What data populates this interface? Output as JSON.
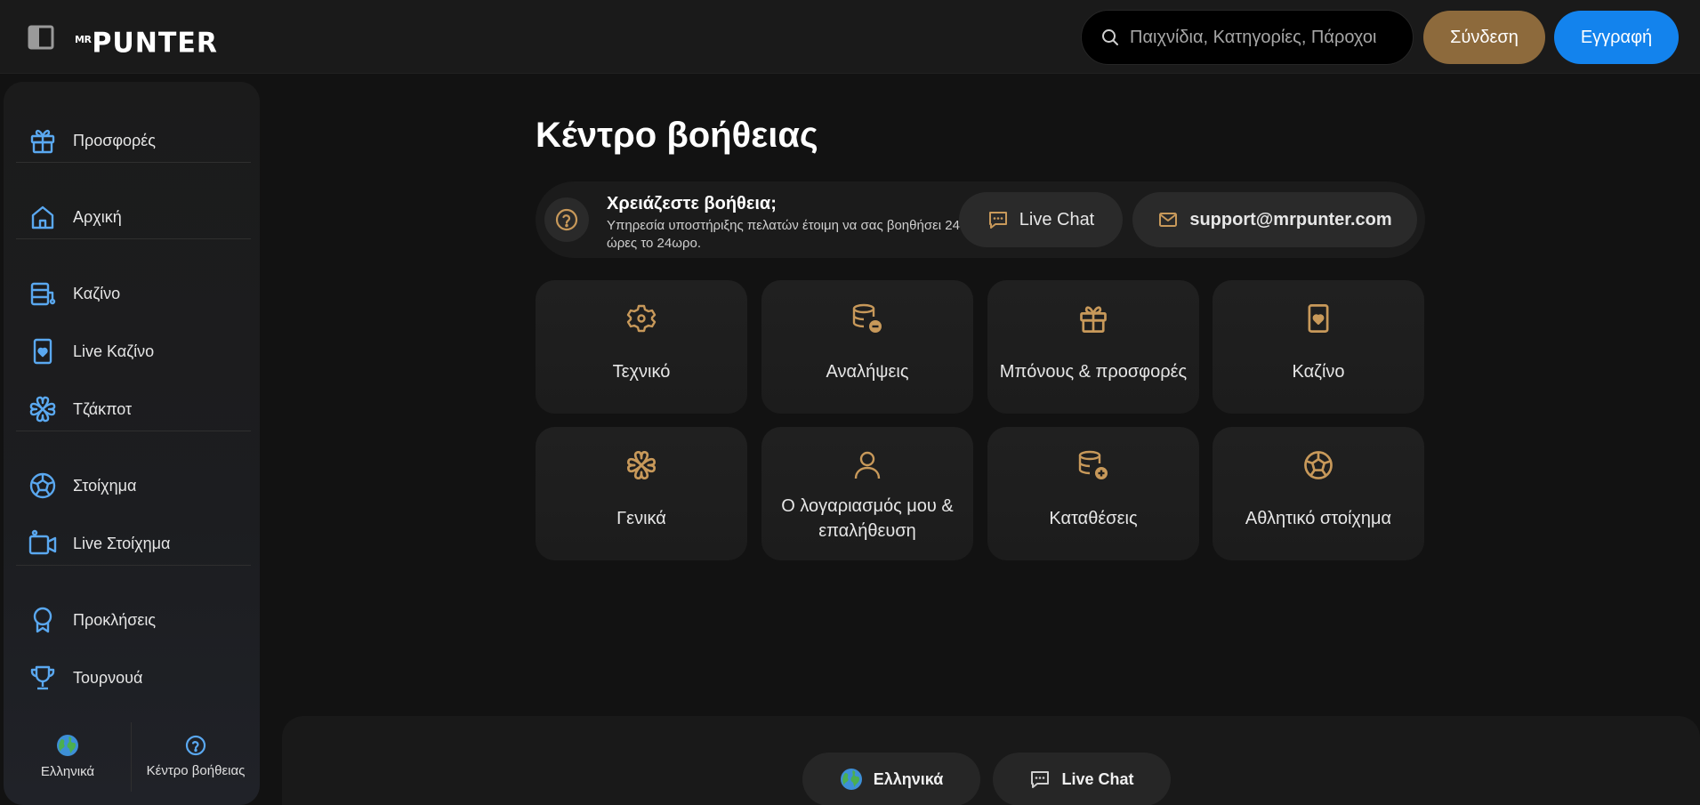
{
  "header": {
    "logo_small": "MR",
    "logo_main": "PUNTER",
    "search_placeholder": "Παιχνίδια, Κατηγορίες, Πάροχοι",
    "login_label": "Σύνδεση",
    "register_label": "Εγγραφή"
  },
  "sidebar": {
    "items": [
      {
        "label": "Προσφορές",
        "icon": "gift-icon"
      },
      {
        "label": "Αρχική",
        "icon": "home-icon"
      },
      {
        "label": "Καζίνο",
        "icon": "casino-icon"
      },
      {
        "label": "Live Καζίνο",
        "icon": "card-heart-icon"
      },
      {
        "label": "Τζάκποτ",
        "icon": "clover-icon"
      },
      {
        "label": "Στοίχημα",
        "icon": "soccer-ball-icon"
      },
      {
        "label": "Live Στοίχημα",
        "icon": "video-camera-icon"
      },
      {
        "label": "Προκλήσεις",
        "icon": "badge-icon"
      },
      {
        "label": "Τουρνουά",
        "icon": "trophy-icon"
      }
    ],
    "bottom": {
      "language_label": "Ελληνικά",
      "help_label": "Κέντρο βοήθειας"
    }
  },
  "main": {
    "title": "Κέντρο βοήθειας",
    "help_bar": {
      "title": "Χρειάζεστε βοήθεια;",
      "subtitle": "Υπηρεσία υποστήριξης πελατών έτοιμη να σας βοηθήσει 24 ώρες το 24ωρο.",
      "live_chat_label": "Live Chat",
      "email_label": "support@mrpunter.com"
    },
    "categories": [
      {
        "label": "Τεχνικό",
        "icon": "gear-icon"
      },
      {
        "label": "Αναλήψεις",
        "icon": "coins-minus-icon"
      },
      {
        "label": "Μπόνους & προσφορές",
        "icon": "gift-icon"
      },
      {
        "label": "Καζίνο",
        "icon": "card-heart-icon"
      },
      {
        "label": "Γενικά",
        "icon": "clover-icon"
      },
      {
        "label": "Ο λογαριασμός μου & επαλήθευση",
        "icon": "user-icon"
      },
      {
        "label": "Καταθέσεις",
        "icon": "coins-plus-icon"
      },
      {
        "label": "Αθλητικό στοίχημα",
        "icon": "soccer-ball-icon"
      }
    ]
  },
  "footer": {
    "language_label": "Ελληνικά",
    "live_chat_label": "Live Chat"
  },
  "colors": {
    "background": "#121212",
    "gold_accent": "#c8995a",
    "blue_accent": "#5aa8f0",
    "login_button": "#8d6a3c",
    "register_button": "#1383ed"
  }
}
